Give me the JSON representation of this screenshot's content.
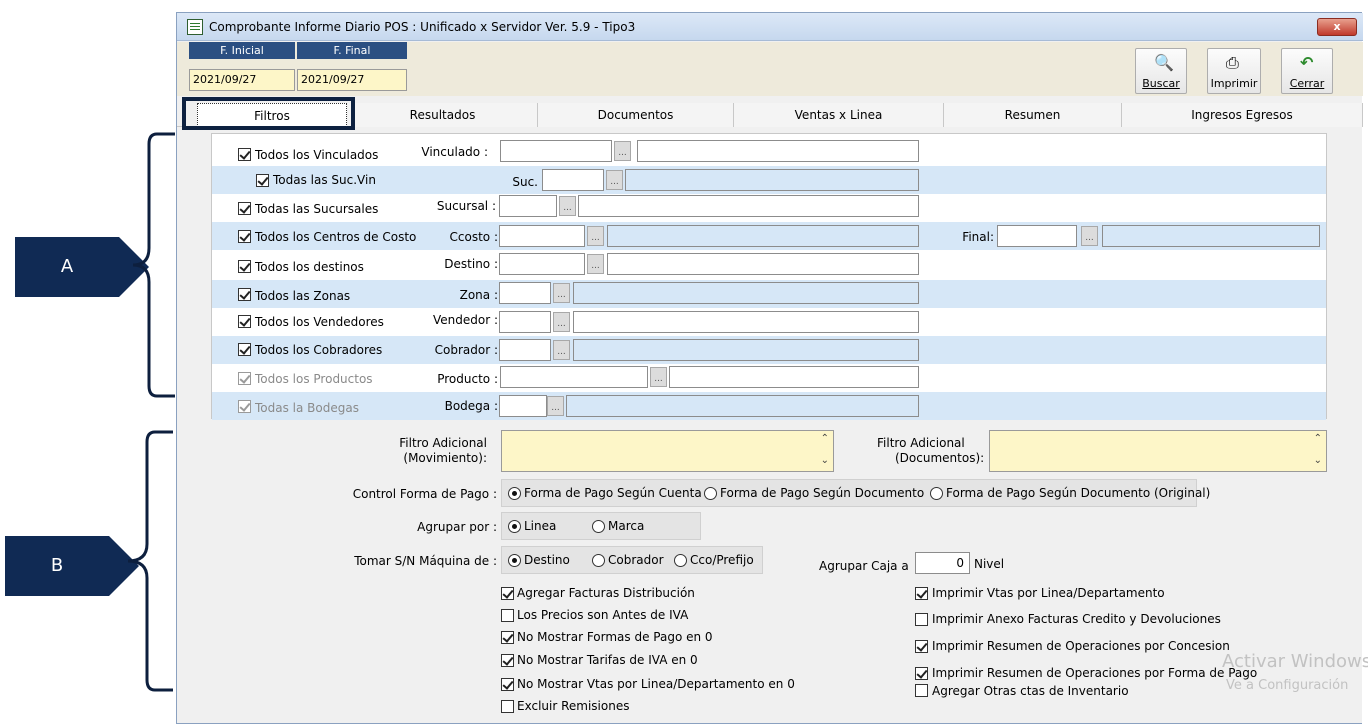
{
  "window": {
    "title": "Comprobante Informe Diario POS : Unificado x Servidor  Ver. 5.9 - Tipo3",
    "close_label": "x"
  },
  "dates": {
    "initial_label": "F. Inicial",
    "final_label": "F. Final",
    "initial_value": "2021/09/27",
    "final_value": "2021/09/27"
  },
  "toolbar": {
    "buscar": "Buscar",
    "imprimir": "Imprimir",
    "cerrar": "Cerrar"
  },
  "tabs": [
    {
      "label": "Filtros",
      "active": true
    },
    {
      "label": "Resultados"
    },
    {
      "label": "Documentos"
    },
    {
      "label": "Ventas x Linea"
    },
    {
      "label": "Resumen"
    },
    {
      "label": "Ingresos Egresos"
    }
  ],
  "filters": {
    "vinculados": {
      "check": "Todos los Vinculados",
      "label": "Vinculado :",
      "checked": true
    },
    "suc_vin": {
      "check": "Todas las Suc.Vin",
      "label": "Suc.",
      "checked": true
    },
    "sucursales": {
      "check": "Todas las Sucursales",
      "label": "Sucursal :",
      "checked": true
    },
    "ccosto": {
      "check": "Todos los Centros de Costo",
      "label": "Ccosto :",
      "final_label": "Final:",
      "checked": true
    },
    "destinos": {
      "check": "Todos los destinos",
      "label": "Destino :",
      "checked": true
    },
    "zonas": {
      "check": "Todos las Zonas",
      "label": "Zona :",
      "checked": true
    },
    "vendedores": {
      "check": "Todos los Vendedores",
      "label": "Vendedor :",
      "checked": true
    },
    "cobradores": {
      "check": "Todos los Cobradores",
      "label": "Cobrador :",
      "checked": true
    },
    "productos": {
      "check": "Todos los Productos",
      "label": "Producto :",
      "checked": true,
      "disabled": true
    },
    "bodegas": {
      "check": "Todas la Bodegas",
      "label": "Bodega :",
      "checked": true,
      "disabled": true
    }
  },
  "lower": {
    "filtro_mov_1": "Filtro Adicional",
    "filtro_mov_2": "(Movimiento):",
    "filtro_doc_1": "Filtro Adicional",
    "filtro_doc_2": "(Documentos):",
    "control_label": "Control Forma  de Pago :",
    "control_options": [
      "Forma de Pago Según Cuenta",
      "Forma de Pago Según Documento",
      "Forma de Pago Según Documento (Original)"
    ],
    "control_selected": "Forma de Pago Según Cuenta",
    "agrupar_label": "Agrupar por :",
    "agrupar_options": [
      "Linea",
      "Marca"
    ],
    "agrupar_selected": "Linea",
    "tomar_label": "Tomar S/N Máquina de :",
    "tomar_options": [
      "Destino",
      "Cobrador",
      "Cco/Prefijo"
    ],
    "tomar_selected": "Destino",
    "agrupar_caja_label": "Agrupar Caja a",
    "agrupar_caja_value": "0",
    "nivel_label": "Nivel",
    "left_checks": [
      {
        "label": "Agregar Facturas Distribución",
        "checked": true
      },
      {
        "label": "Los Precios son Antes de IVA",
        "checked": false
      },
      {
        "label": "No Mostrar  Formas de Pago en 0",
        "checked": true
      },
      {
        "label": "No Mostrar Tarifas de IVA  en  0",
        "checked": true
      },
      {
        "label": "No Mostrar  Vtas por Linea/Departamento en  0",
        "checked": true
      },
      {
        "label": "Excluir Remisiones",
        "checked": false
      }
    ],
    "right_checks": [
      {
        "label": "Imprimir Vtas por Linea/Departamento",
        "checked": true
      },
      {
        "label": "Imprimir Anexo Facturas Credito y Devoluciones",
        "checked": false
      },
      {
        "label": "Imprimir Resumen de Operaciones por Concesion",
        "checked": true
      },
      {
        "label": "Imprimir Resumen de Operaciones por Forma de Pago",
        "checked": true
      },
      {
        "label": "Agregar Otras ctas de Inventario",
        "checked": false
      }
    ]
  },
  "annotations": {
    "a": "A",
    "b": "B"
  },
  "watermark": {
    "line1": "Activar Windows",
    "line2": "Ve a Configuración"
  },
  "colors": {
    "accent": "#2b4f82",
    "row_blue": "#d6e7f7",
    "yellow_field": "#fdf6c8",
    "marker": "#102a54"
  }
}
